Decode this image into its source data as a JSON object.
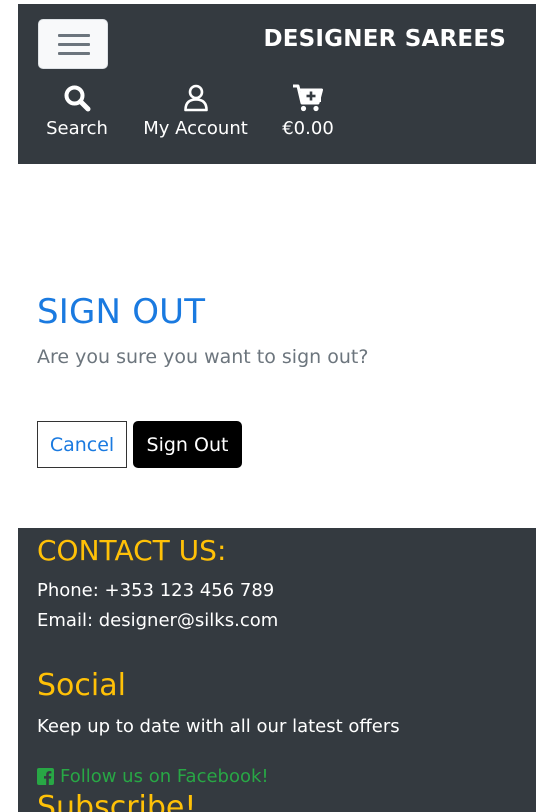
{
  "header": {
    "brand": "DESIGNER SAREES",
    "nav": {
      "search_label": "Search",
      "account_label": "My Account",
      "cart_total": "€0.00"
    },
    "icons": [
      "menu-icon",
      "search-icon",
      "user-icon",
      "cart-plus-icon"
    ]
  },
  "main": {
    "title": "SIGN OUT",
    "question": "Are you sure you want to sign out?",
    "cancel_label": "Cancel",
    "signout_label": "Sign Out"
  },
  "footer": {
    "contact_heading": "CONTACT US:",
    "phone": "Phone: +353 123 456 789",
    "email": "Email: designer@silks.com",
    "social_heading": "Social",
    "offers_text": "Keep up to date with all our latest offers",
    "facebook_text": "Follow us on Facebook!",
    "subscribe_heading": "Subscribe!"
  },
  "colors": {
    "header_bg": "#343a40",
    "title_blue": "#1a7ae0",
    "footer_heading": "#ffc107",
    "facebook_green": "#28a745"
  }
}
